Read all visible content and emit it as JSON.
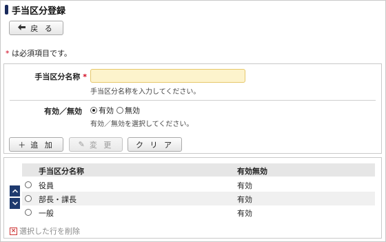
{
  "header": {
    "title": "手当区分登録"
  },
  "toolbar": {
    "back_label": "戻 る",
    "back_icon": "arrow-left-icon"
  },
  "required_note": {
    "star": "*",
    "text": " は必須項目です。"
  },
  "form": {
    "name_field": {
      "label": "手当区分名称",
      "required_star": "*",
      "value": "",
      "hint": "手当区分名称を入力してください。"
    },
    "status_field": {
      "label": "有効／無効",
      "options": [
        {
          "label": "有効",
          "checked": true
        },
        {
          "label": "無効",
          "checked": false
        }
      ],
      "hint": "有効／無効を選択してください。"
    }
  },
  "actions": {
    "add_label": "追 加",
    "add_icon": "＋",
    "update_label": "変 更",
    "update_icon": "✎",
    "clear_label": "ク リ ア"
  },
  "table": {
    "columns": [
      "手当区分名称",
      "有効無効"
    ],
    "rows": [
      {
        "name": "役員",
        "status": "有効"
      },
      {
        "name": "部長・課長",
        "status": "有効"
      },
      {
        "name": "一般",
        "status": "有効"
      }
    ]
  },
  "list_footer": {
    "delete_label": "選択した行を削除"
  },
  "colors": {
    "title_mark": "#1a2a5c",
    "required": "#d0021b",
    "input_bg": "#fdf3cc",
    "sort_btn": "#1e3a6e"
  }
}
